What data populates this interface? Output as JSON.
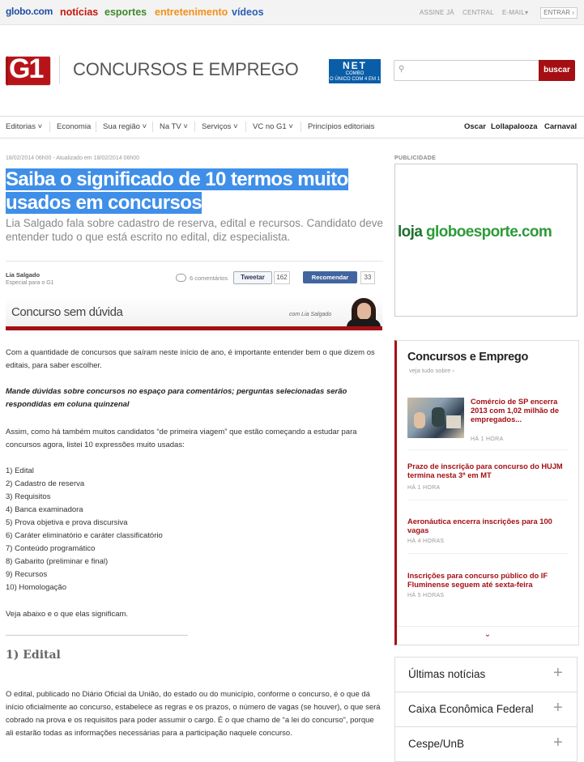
{
  "globobar": {
    "brand": "globo.com",
    "nav": [
      {
        "label": "notícias",
        "color": "#c4170c"
      },
      {
        "label": "esportes",
        "color": "#3f8a2a"
      },
      {
        "label": "entretenimento",
        "color": "#f29017"
      },
      {
        "label": "vídeos",
        "color": "#2a5fb4"
      }
    ],
    "right": [
      "ASSINE JÁ",
      "CENTRAL",
      "E-MAIL"
    ],
    "email_arrow": "▾",
    "entrar": "ENTRAR ›"
  },
  "header": {
    "logo": "G1",
    "section": "CONCURSOS E EMPREGO",
    "sponsor_top": "NET",
    "sponsor_bottom": "COMBO",
    "sponsor_tag": "O ÚNICO COM 4 EM 1",
    "search_placeholder": "",
    "search_button": "buscar"
  },
  "menu": {
    "items": [
      "Editorias ˅",
      "Economia",
      "Sua região ˅",
      "Na TV ˅",
      "Serviços ˅",
      "VC no G1 ˅",
      "Princípios editoriais"
    ],
    "right": [
      "Oscar",
      "Lollapalooza",
      "Carnaval"
    ]
  },
  "article": {
    "dateline": "18/02/2014 06h00 - Atualizado em 18/02/2014 06h00",
    "title": "Saiba o significado de 10 termos muito usados em concursos",
    "subtitle": "Lia Salgado fala sobre cadastro de reserva, edital e recursos. Candidato deve entender tudo o que está escrito no edital, diz especialista.",
    "author": "Lia Salgado",
    "author_role": "Especial para o G1",
    "comments": "6 comentários",
    "tweet_label": "Tweetar",
    "tweet_count": "162",
    "fb_label": "Recomendar",
    "fb_count": "33",
    "banner_title": "Concurso sem dúvida",
    "banner_credit": "com Lia Salgado",
    "p1": "Com a quantidade de concursos que saíram neste início de ano, é importante entender bem o que dizem os editais, para saber escolher.",
    "p2": "Mande dúvidas sobre concursos no espaço para comentários; perguntas selecionadas serão respondidas em coluna quinzenal",
    "p3": "Assim, como há também muitos candidatos “de primeira viagem” que estão começando a estudar para concursos agora, listei 10 expressões muito usadas:",
    "list": [
      "1) Edital",
      "2) Cadastro de reserva",
      "3) Requisitos",
      "4) Banca examinadora",
      "5) Prova objetiva e prova discursiva",
      "6) Caráter eliminatório e caráter classificatório",
      "7) Conteúdo programático",
      "8) Gabarito (preliminar e final)",
      "9) Recursos",
      "10) Homologação"
    ],
    "p4": "Veja abaixo e o que elas significam.",
    "h1": "1) Edital",
    "p5": "O edital, publicado no Diário Oficial da União, do estado ou do município, conforme o concurso, é o que dá início oficialmente ao concurso, estabelece as regras e os prazos, o número de vagas (se houver), o que será cobrado na prova e os requisitos para poder assumir o cargo. É o que chamo de “a lei do concurso”, porque ali estarão todas as informações necessárias para a participação naquele concurso."
  },
  "sidebar": {
    "pub_label": "PUBLICIDADE",
    "ad_loja": "loja",
    "ad_brand": "globoesporte.com",
    "box_title": "Concursos e Emprego",
    "box_link": "veja tudo sobre ›",
    "news": [
      {
        "title": "Comércio de SP encerra 2013 com 1,02 milhão de empregados...",
        "time": "HÁ 1 HORA"
      },
      {
        "title": "Prazo de inscrição para concurso do HUJM termina nesta 3ª em MT",
        "time": "HÁ 1 HORA"
      },
      {
        "title": "Aeronáutica encerra inscrições para 100 vagas",
        "time": "HÁ 4 HORAS"
      },
      {
        "title": "Inscrições para concurso público do IF Fluminense seguem até sexta-feira",
        "time": "HÁ 5 HORAS"
      }
    ],
    "more_icon": "⌄",
    "accordion": [
      "Últimas notícias",
      "Caixa Econômica Federal",
      "Cespe/UnB"
    ],
    "plus": "+"
  }
}
